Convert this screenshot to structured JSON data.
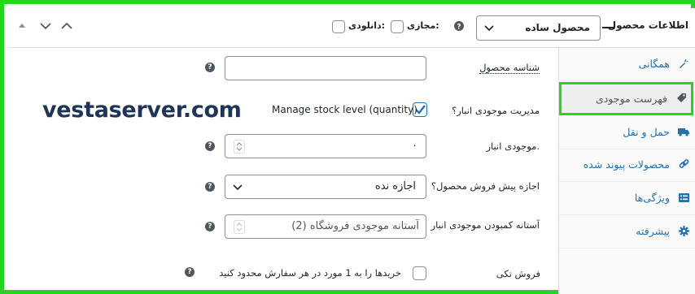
{
  "header": {
    "title": "اطلاعات محصول",
    "product_type": "محصول ساده",
    "virtual_label": "مجازی:",
    "downloadable_label": "دانلودی:"
  },
  "sidebar": {
    "items": [
      {
        "label": "همگانی",
        "icon": "wrench-icon"
      },
      {
        "label": "فهرست موجودی",
        "icon": "tag-icon",
        "active": true
      },
      {
        "label": "حمل و نقل",
        "icon": "truck-icon"
      },
      {
        "label": "محصولات پیوند شده",
        "icon": "link-icon"
      },
      {
        "label": "ویژگی‌ها",
        "icon": "list-icon"
      },
      {
        "label": "پیشرفته",
        "icon": "gear-icon"
      }
    ]
  },
  "inventory": {
    "sku_label": "شناسه محصول",
    "sku_value": "",
    "manage_label": "مدیریت موجودی انبار؟",
    "manage_text": "Manage stock level (quantity)",
    "manage_checked": true,
    "stock_label": "موجودی انبار.",
    "stock_value": "۰",
    "backorders_label": "اجازه پیش فروش محصول؟",
    "backorders_value": "اجازه نده",
    "low_stock_label": "آستانه کمبودن موجودی انبار",
    "low_stock_placeholder": "آستانه موجودی فروشگاه (2)",
    "sold_individually_label": "فروش تکی",
    "sold_individually_text": "خریدها را به 1 مورد در هر سفارش محدود کنید",
    "help_glyph": "?"
  },
  "watermark": "vestaserver.com",
  "colors": {
    "accent": "#2271b1",
    "highlight": "#24d61f",
    "watermark": "#1f3557"
  }
}
